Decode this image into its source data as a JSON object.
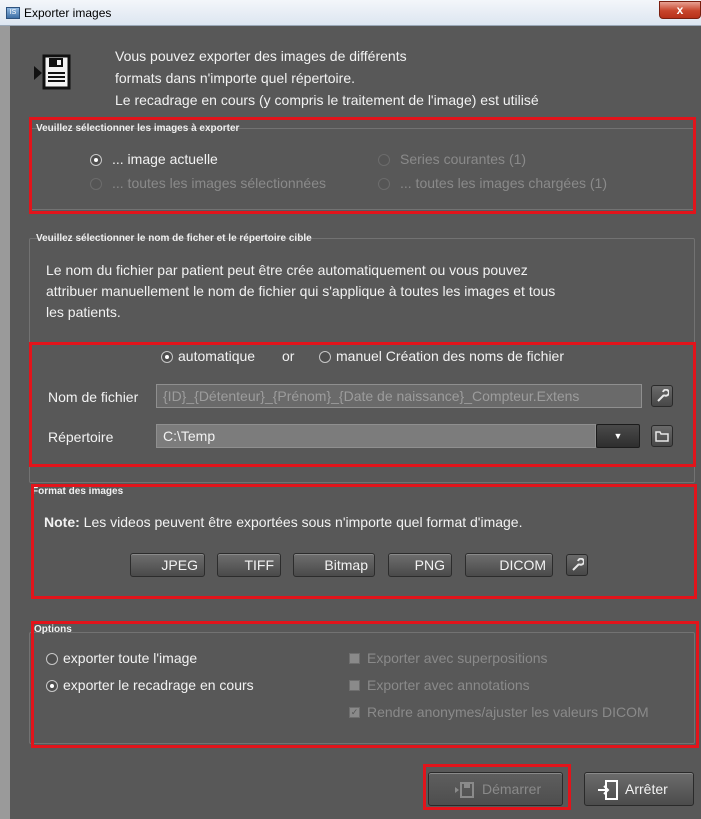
{
  "window": {
    "title": "Exporter images",
    "app_icon": "app-icon",
    "close_label": "x"
  },
  "intro": {
    "line1": "Vous pouvez exporter des images de différents",
    "line2": "formats dans n'importe quel répertoire.",
    "line3": "Le recadrage en cours (y compris le traitement de l'image) est utilisé",
    "icon": "save-disk-icon"
  },
  "select_images": {
    "title": "Veuillez sélectionner les images à exporter",
    "options": [
      {
        "label": "... image actuelle",
        "selected": true,
        "enabled": true
      },
      {
        "label": "Series courantes (1)",
        "selected": false,
        "enabled": false
      },
      {
        "label": "... toutes les images sélectionnées",
        "selected": false,
        "enabled": false
      },
      {
        "label": "... toutes les images chargées (1)",
        "selected": false,
        "enabled": false
      }
    ]
  },
  "file_target": {
    "title": "Veuillez sélectionner le nom de ficher et le répertoire cible",
    "description": [
      "Le nom du fichier par patient peut être crée automatiquement ou vous pouvez",
      "attribuer manuellement le nom de fichier qui s'applique à toutes les images et tous",
      "les patients."
    ],
    "mode_auto": "automatique",
    "mode_or": "or",
    "mode_manual": "manuel Création des noms de fichier",
    "filename_label": "Nom de fichier",
    "filename_value": "{ID}_{Détenteur}_{Prénom}_{Date de naissance}_Compteur.Extens",
    "directory_label": "Répertoire",
    "directory_value": "C:\\Temp"
  },
  "formats": {
    "title": "Format des images",
    "note_bold": "Note:",
    "note_text": " Les videos peuvent être exportées sous n'importe quel format d'image.",
    "buttons": [
      "JPEG",
      "TIFF",
      "Bitmap",
      "PNG",
      "DICOM"
    ]
  },
  "options": {
    "title": "Options",
    "radio_full": "exporter toute l'image",
    "radio_crop": "exporter le recadrage en cours",
    "check_overlays": "Exporter avec superpositions",
    "check_annotations": "Exporter avec annotations",
    "check_anonymize": "Rendre anonymes/ajuster les valeurs DICOM"
  },
  "footer": {
    "start_label": "Démarrer",
    "stop_label": "Arrêter"
  },
  "colors": {
    "background": "#585858",
    "highlight": "#e2141b"
  }
}
